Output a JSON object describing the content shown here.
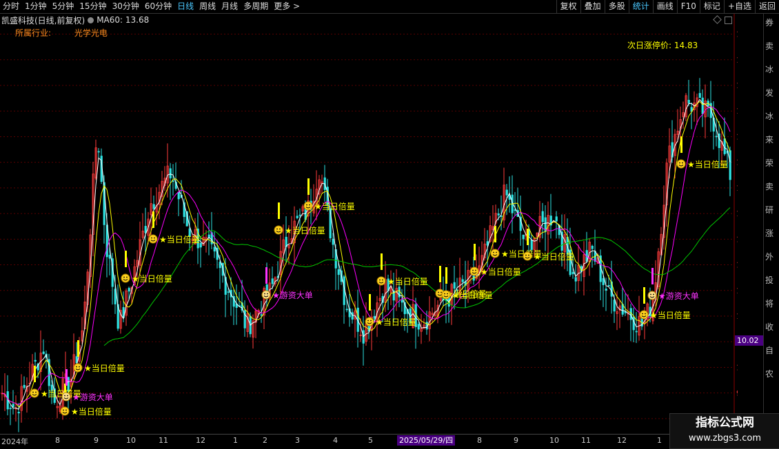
{
  "topbar": {
    "periods": [
      "分时",
      "1分钟",
      "5分钟",
      "15分钟",
      "30分钟",
      "60分钟",
      "日线",
      "周线",
      "月线",
      "多周期",
      "更多 >"
    ],
    "active_period": "日线",
    "right_buttons": [
      "复权",
      "叠加",
      "多股",
      "统计",
      "画线",
      "F10",
      "标记",
      "+自选",
      "返回"
    ],
    "highlight_button": "统计"
  },
  "title": "凯盛科技(日线,前复权)",
  "ma60_label": "MA60: 13.68",
  "industry_label": "所属行业:",
  "industry_value": "光学光电",
  "limit_up_label": "次日涨停价: 14.83",
  "current_price": "10.02",
  "colors": {
    "up": "#ff3c3c",
    "down": "#2ee3e3",
    "ma5": "#ffffff",
    "ma10": "#ffff00",
    "ma20": "#ff00ff",
    "ma60": "#00c800",
    "signal_yellow": "#ffff00",
    "signal_magenta": "#ff33ff",
    "price_axis": "#ff3c3c",
    "date_highlight": "#4b0082"
  },
  "chart_data": {
    "type": "candlestick",
    "y_ticks": [
      "16.50",
      "16.00",
      "15.50",
      "15.00",
      "14.50",
      "14.00",
      "13.50",
      "13.00",
      "12.50",
      "12.00",
      "11.50",
      "11.00",
      "10.50",
      "10.00",
      "9.50",
      "9.00"
    ],
    "ylim": [
      8.73,
      16.87
    ],
    "x_labels": [
      "2024年",
      "8",
      "9",
      "10",
      "11",
      "12",
      "1",
      "2",
      "3",
      "4",
      "5",
      "2025/05/29/四",
      "8",
      "9",
      "10",
      "11",
      "12",
      "1"
    ],
    "series": [
      {
        "name": "MA60",
        "value": 13.68
      }
    ],
    "signals": [
      {
        "label": "当日倍量",
        "count": 16
      },
      {
        "label": "游资大单",
        "count": 4
      }
    ]
  },
  "right_pane_text": [
    "券",
    "卖",
    "冰",
    "发",
    "冰",
    "来",
    "荣",
    "卖",
    "研",
    "涨",
    "外",
    "投",
    "将",
    "收",
    "自",
    "农"
  ],
  "watermark": {
    "line1": "指标公式网",
    "line2": "www.zbgs3.com"
  }
}
